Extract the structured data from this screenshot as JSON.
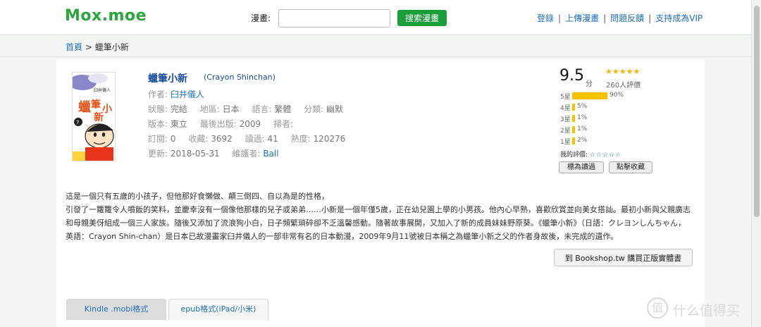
{
  "header": {
    "logo": "Mox.moe",
    "search_label": "漫畫:",
    "search_placeholder": "",
    "search_button": "搜索漫畫",
    "links": [
      "登錄",
      "上傳漫畫",
      "問題反饋",
      "支持成為VIP"
    ]
  },
  "breadcrumb": {
    "home": "首頁",
    "separator": ">",
    "current": "蠟筆小新"
  },
  "book": {
    "title": "蠟筆小新",
    "title_en": "(Crayon Shinchan)",
    "author_label": "作者:",
    "author": "臼井儀人",
    "status_label": "狀態:",
    "status": "完結",
    "region_label": "地區:",
    "region": "日本",
    "language_label": "語言:",
    "language": "繁體",
    "category_label": "分類:",
    "category": "幽默",
    "edition_label": "版本:",
    "edition": "東立",
    "last_pub_label": "最後出版:",
    "last_pub": "2009",
    "scanner_label": "掃者:",
    "scanner": "",
    "subscribe_label": "訂閱:",
    "subscribe": "0",
    "favorites_label": "收藏:",
    "favorites": "3692",
    "reads_label": "讀過:",
    "reads": "41",
    "heat_label": "熱度:",
    "heat": "120276",
    "updated_label": "更新:",
    "updated": "2018-05-31",
    "maintainer_label": "維護者:",
    "maintainer": "Ball"
  },
  "rating": {
    "score": "9.5",
    "unit": "分",
    "stars": "★★★★★",
    "reviews": "260人評價",
    "distribution": [
      {
        "label": "5星",
        "percent": 90,
        "text": "90%"
      },
      {
        "label": "4星",
        "percent": 5,
        "text": "5%"
      },
      {
        "label": "3星",
        "percent": 1,
        "text": "1%"
      },
      {
        "label": "2星",
        "percent": 1,
        "text": "1%"
      },
      {
        "label": "1星",
        "percent": 2,
        "text": "2%"
      }
    ],
    "my_rating_label": "我的評價:",
    "my_rating_stars": "☆☆☆☆☆",
    "mark_read": "標為讀過",
    "favorite": "點擊收藏"
  },
  "description": [
    "這是一個只有五歲的小孩子，但他那好食懶做、顛三倒四、自以為是的性格，",
    "引發了一籮籮令人噴飯的笑料，並慶幸沒有一個像他那樣的兒子或弟弟……小新是一個年僅5歲，正在幼兒園上學的小男孩。他內心早熟，喜歡欣賞並向美女搭訕。最初小新與父親廣志",
    "和母親美伢組成一個三人家族。隨後又添加了流浪狗小白，日子頻繁瑣碎卻不乏溫馨感動。隨著故事展開，又加入了新的成員妹妹野原葵。《蠟筆小新》（日語：クレヨンしんちゃん，",
    "英語：Crayon Shin-chan）是日本已故漫畫家臼井儀人的一部非常有名的日本動漫，2009年9月11號被日本稱之為蠟筆小新之父的作者身故後，未完成的遺作。"
  ],
  "bookshop_button": "到 Bookshop.tw 購買正版實體書",
  "tabs": [
    "Kindle .mobi格式",
    "epub格式(iPad/小米)"
  ],
  "watermark": "什么值得买",
  "colors": {
    "brand_green": "#2aa63b",
    "button_green": "#1a9e3a",
    "link_blue": "#1f6fb5",
    "star_gold": "#f5b400"
  }
}
